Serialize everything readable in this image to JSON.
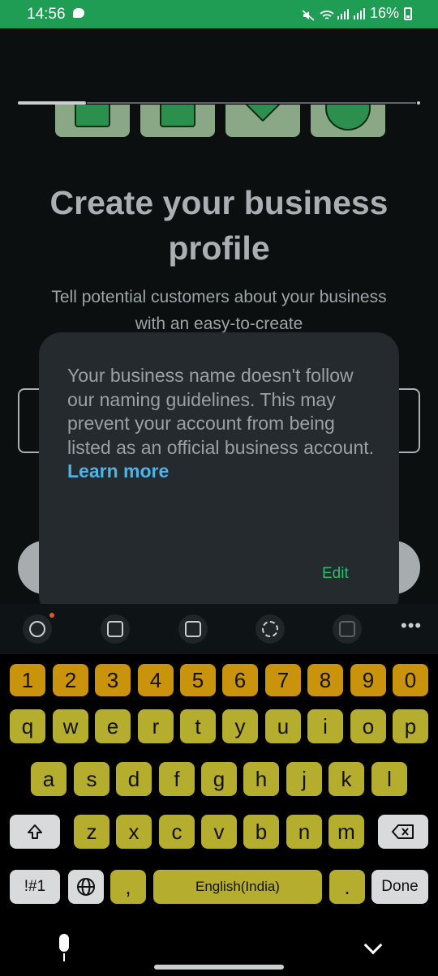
{
  "status_bar": {
    "time": "14:56",
    "battery": "16%",
    "icons": [
      "chat-icon",
      "mute-icon",
      "wifi-icon",
      "volte-signal-icon",
      "call-signal-icon",
      "battery-icon"
    ]
  },
  "page": {
    "heading": "Create your business profile",
    "subtext": "Tell potential customers about your business with an easy-to-create",
    "progress_fraction": 0.17
  },
  "dialog": {
    "message": "Your business name doesn't follow our naming guidelines. This may prevent your account from being listed as an official business account.",
    "link": "Learn more",
    "action": "Edit"
  },
  "keyboard_toolbar": {
    "icons": [
      "emoji-icon",
      "clipboard-icon",
      "translate-icon",
      "settings-icon",
      "sync-icon",
      "more-icon"
    ]
  },
  "keyboard": {
    "number_row": [
      "1",
      "2",
      "3",
      "4",
      "5",
      "6",
      "7",
      "8",
      "9",
      "0"
    ],
    "row1": [
      "q",
      "w",
      "e",
      "r",
      "t",
      "y",
      "u",
      "i",
      "o",
      "p"
    ],
    "row2": [
      "a",
      "s",
      "d",
      "f",
      "g",
      "h",
      "j",
      "k",
      "l"
    ],
    "row3": [
      "z",
      "x",
      "c",
      "v",
      "b",
      "n",
      "m"
    ],
    "symbols_key": "!#1",
    "comma_key": ",",
    "space_label": "English(India)",
    "period_key": ".",
    "done_key": "Done"
  },
  "colors": {
    "status_bar": "#1f9d55",
    "dialog_bg": "#242a2d",
    "link": "#4fb3e6",
    "action": "#26c06a",
    "key_letter": "#b5ad2d",
    "key_number": "#c9940c"
  }
}
